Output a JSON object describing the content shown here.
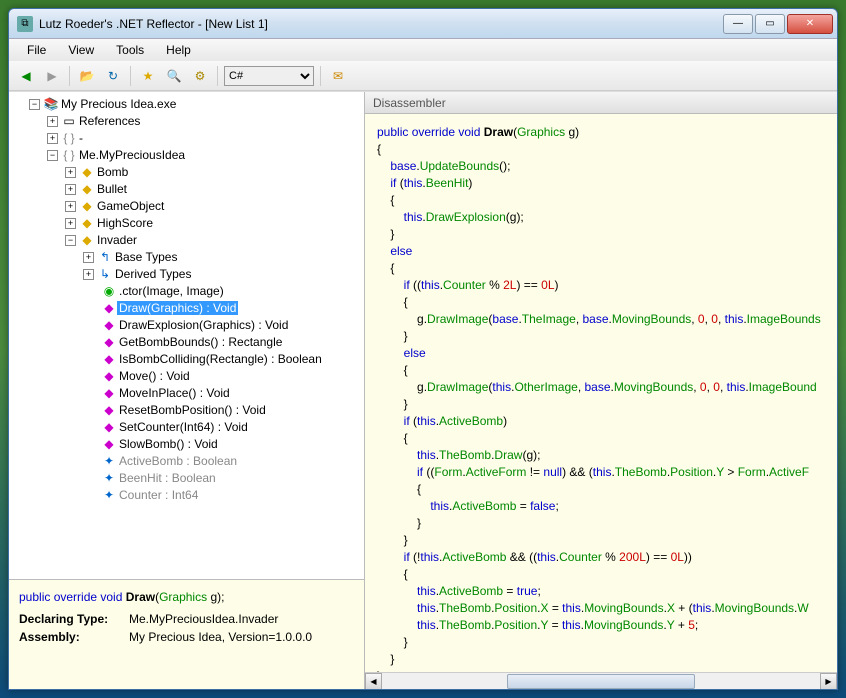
{
  "window": {
    "title": "Lutz Roeder's .NET Reflector - [New List 1]"
  },
  "menu": [
    "File",
    "View",
    "Tools",
    "Help"
  ],
  "toolbar": {
    "back_icon": "◀",
    "fwd_icon": "▶",
    "open_icon": "📂",
    "refresh_icon": "↻",
    "fav_icon": "★",
    "search_icon": "🔍",
    "opt_icon": "⚙",
    "lang": "C#",
    "mail_icon": "✉"
  },
  "tree": {
    "root": "My Precious Idea.exe",
    "references": "References",
    "dash": "-",
    "namespace": "Me.MyPreciousIdea",
    "classes": [
      "Bomb",
      "Bullet",
      "GameObject",
      "HighScore"
    ],
    "invader": "Invader",
    "basetypes": "Base Types",
    "derivedtypes": "Derived Types",
    "ctor": ".ctor(Image, Image)",
    "draw": "Draw(Graphics) : Void",
    "methods": [
      "DrawExplosion(Graphics) : Void",
      "GetBombBounds() : Rectangle",
      "IsBombColliding(Rectangle) : Boolean",
      "Move() : Void",
      "MoveInPlace() : Void",
      "ResetBombPosition() : Void",
      "SetCounter(Int64) : Void",
      "SlowBomb() : Void"
    ],
    "props": [
      "ActiveBomb : Boolean",
      "BeenHit : Boolean",
      "Counter : Int64"
    ]
  },
  "info": {
    "declaring_type_key": "Declaring Type:",
    "declaring_type_val": "Me.MyPreciousIdea.Invader",
    "assembly_key": "Assembly:",
    "assembly_val": "My Precious Idea, Version=1.0.0.0"
  },
  "dis": {
    "header": "Disassembler"
  },
  "sig": {
    "kw1": "public override void",
    "name": "Draw",
    "paramtype": "Graphics",
    "paramname": "g"
  },
  "code": {
    "l1_kw": "public override void ",
    "l1_nm": "Draw",
    "l1_pt": "Graphics",
    "l1_pn": " g",
    "l3_kw": "base",
    "l3_m": "UpdateBounds",
    "l4_if": "if ",
    "l4_this": "this",
    "l4_p": "BeenHit",
    "l6_this": "this",
    "l6_m": "DrawExplosion",
    "l6_a": "g",
    "l8_else": "else",
    "l10_if": "if ",
    "l10_this": "this",
    "l10_p": "Counter",
    "l10_lit1": "2L",
    "l10_lit2": "0L",
    "l12_g": "g",
    "l12_m": "DrawImage",
    "l12_base": "base",
    "l12_a1": "TheImage",
    "l12_a2": "MovingBounds",
    "l12_z": "0",
    "l12_this": "this",
    "l12_a3": "ImageBounds",
    "l14_else": "else",
    "l16_g": "g",
    "l16_m": "DrawImage",
    "l16_this": "this",
    "l16_a1": "OtherImage",
    "l16_base": "base",
    "l16_a2": "MovingBounds",
    "l16_z": "0",
    "l16_a3": "ImageBound",
    "l18_if": "if ",
    "l18_this": "this",
    "l18_p": "ActiveBomb",
    "l20_this": "this",
    "l20_b": "TheBomb",
    "l20_m": "Draw",
    "l20_a": "g",
    "l21_if": "if ",
    "l21_form": "Form",
    "l21_af": "ActiveForm",
    "l21_null": "null",
    "l21_this": "this",
    "l21_tb": "TheBomb",
    "l21_pos": "Position",
    "l21_y": "Y",
    "l21_form2": "Form",
    "l21_af2": "ActiveF",
    "l23_this": "this",
    "l23_p": "ActiveBomb",
    "l23_false": "false",
    "l26_if": "if ",
    "l26_this": "this",
    "l26_p": "ActiveBomb",
    "l26_this2": "this",
    "l26_c": "Counter",
    "l26_lit1": "200L",
    "l26_lit2": "0L",
    "l28_this": "this",
    "l28_p": "ActiveBomb",
    "l28_true": "true",
    "l29_this": "this",
    "l29_tb": "TheBomb",
    "l29_pos": "Position",
    "l29_x": "X",
    "l29_this2": "this",
    "l29_mb": "MovingBounds",
    "l29_x2": "X",
    "l29_this3": "this",
    "l29_mb2": "MovingBounds",
    "l29_w": "W",
    "l30_this": "this",
    "l30_tb": "TheBomb",
    "l30_pos": "Position",
    "l30_y": "Y",
    "l30_this2": "this",
    "l30_mb": "MovingBounds",
    "l30_y2": "Y",
    "l30_five": "5"
  }
}
